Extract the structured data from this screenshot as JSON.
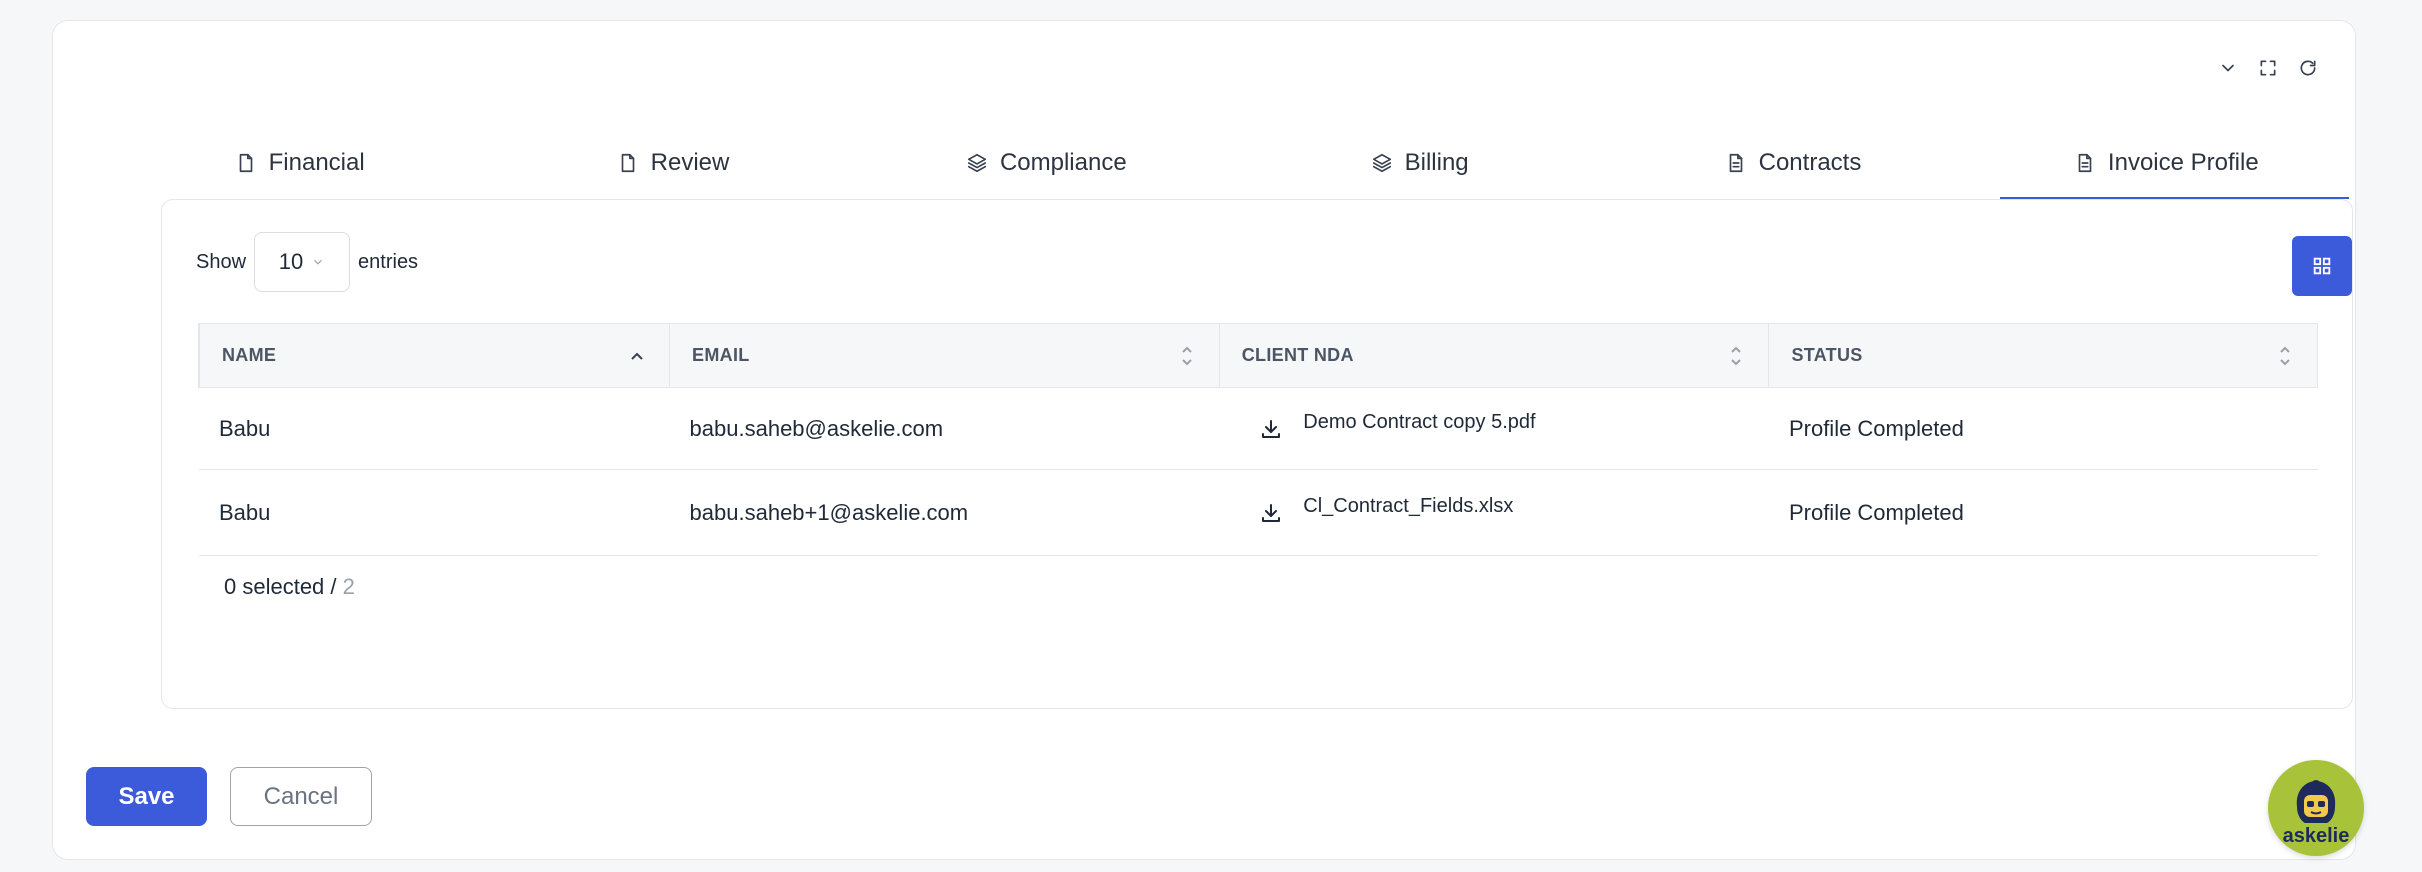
{
  "tabs": [
    {
      "label": "Financial",
      "icon": "file-icon"
    },
    {
      "label": "Review",
      "icon": "file-icon"
    },
    {
      "label": "Compliance",
      "icon": "layers-icon"
    },
    {
      "label": "Billing",
      "icon": "layers-icon"
    },
    {
      "label": "Contracts",
      "icon": "file-text-icon"
    },
    {
      "label": "Invoice Profile",
      "icon": "file-text-icon",
      "active": true
    }
  ],
  "toolbar": {
    "show_label": "Show",
    "page_size": "10",
    "entries_label": "entries"
  },
  "table": {
    "columns": [
      "NAME",
      "EMAIL",
      "CLIENT NDA",
      "STATUS"
    ],
    "rows": [
      {
        "name": "Babu",
        "email": "babu.saheb@askelie.com",
        "nda": "Demo Contract copy 5.pdf",
        "status": "Profile Completed"
      },
      {
        "name": "Babu",
        "email": "babu.saheb+1@askelie.com",
        "nda": "Cl_Contract_Fields.xlsx",
        "status": "Profile Completed"
      }
    ]
  },
  "selection": {
    "selected": "0 selected / ",
    "total": "2"
  },
  "footer": {
    "save_label": "Save",
    "cancel_label": "Cancel"
  },
  "assistant": {
    "label": "askelie"
  },
  "colors": {
    "accent": "#3b5bdb",
    "assistant_bg": "#a8c23a"
  }
}
